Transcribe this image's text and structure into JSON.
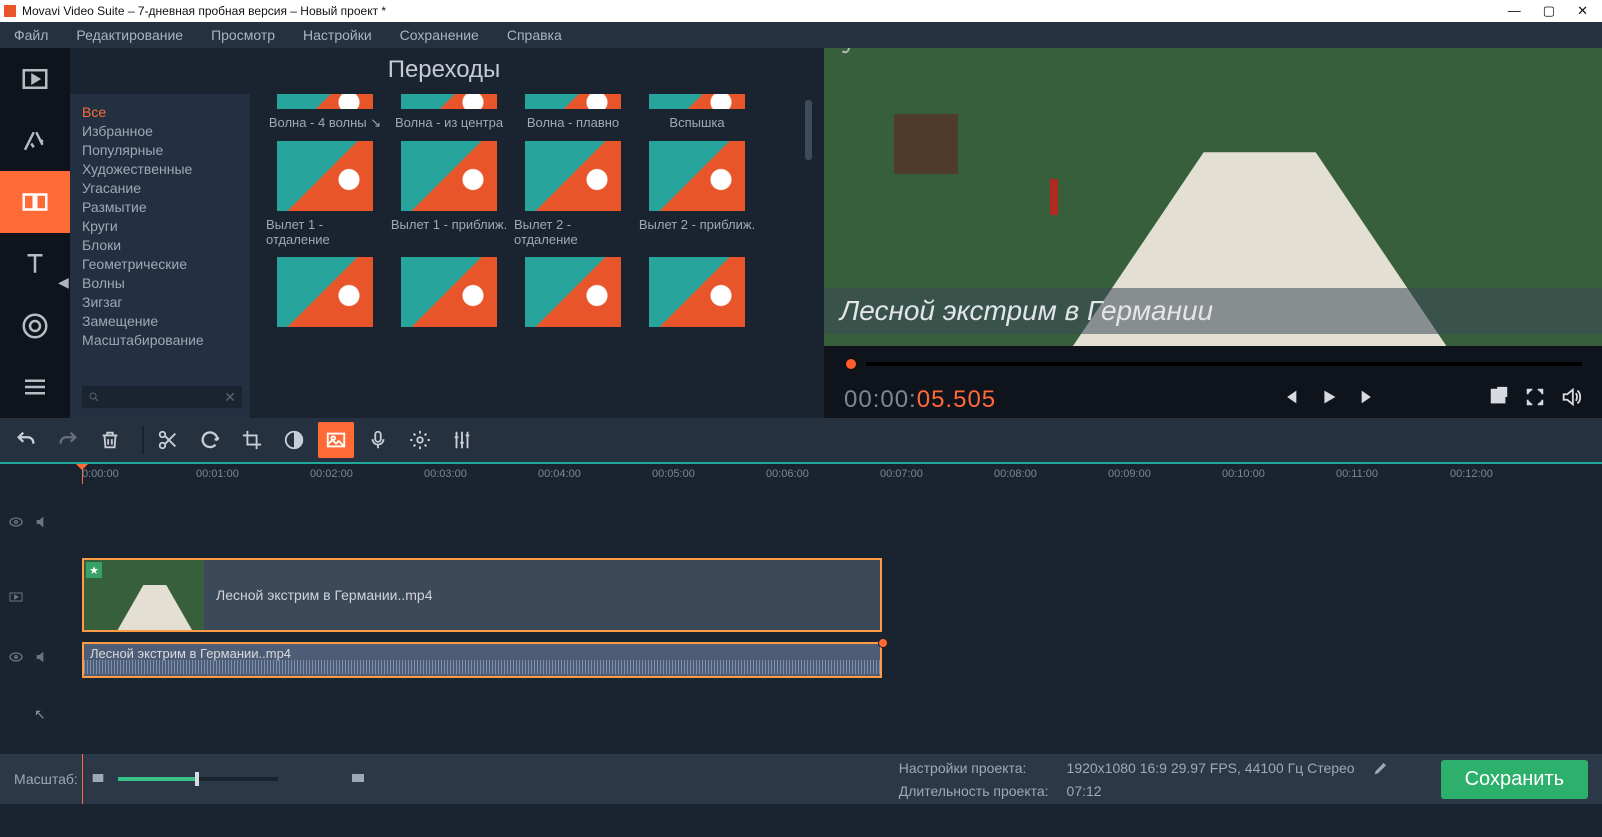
{
  "window": {
    "title": "Movavi Video Suite – 7-дневная пробная версия – Новый проект *"
  },
  "menu": [
    "Файл",
    "Редактирование",
    "Просмотр",
    "Настройки",
    "Сохранение",
    "Справка"
  ],
  "gallery": {
    "title": "Переходы",
    "categories": [
      "Все",
      "Избранное",
      "Популярные",
      "Художественные",
      "Угасание",
      "Размытие",
      "Круги",
      "Блоки",
      "Геометрические",
      "Волны",
      "Зигзаг",
      "Замещение",
      "Масштабирование"
    ],
    "active_category": 0,
    "row0": [
      "Волна - 4 волны ↘",
      "Волна - из центра",
      "Волна - плавно",
      "Вспышка"
    ],
    "row1": [
      "Вылет 1 - отдаление",
      "Вылет 1 - приближ.",
      "Вылет 2 - отдаление",
      "Вылет 2 - приближ."
    ]
  },
  "preview": {
    "watermark": "JkFam",
    "caption": "Лесной экстрим в Германии",
    "timecode_gray": "00:00:",
    "timecode_color": "05.505"
  },
  "ruler": [
    {
      "l": 82,
      "t": "0:00:00"
    },
    {
      "l": 196,
      "t": "00:01:00"
    },
    {
      "l": 310,
      "t": "00:02:00"
    },
    {
      "l": 424,
      "t": "00:03:00"
    },
    {
      "l": 538,
      "t": "00:04:00"
    },
    {
      "l": 652,
      "t": "00:05:00"
    },
    {
      "l": 766,
      "t": "00:06:00"
    },
    {
      "l": 880,
      "t": "00:07:00"
    },
    {
      "l": 994,
      "t": "00:08:00"
    },
    {
      "l": 1108,
      "t": "00:09:00"
    },
    {
      "l": 1222,
      "t": "00:10:00"
    },
    {
      "l": 1336,
      "t": "00:11:00"
    },
    {
      "l": 1450,
      "t": "00:12:00"
    }
  ],
  "clips": {
    "video_label": "Лесной экстрим в Германии..mp4",
    "audio_label": "Лесной экстрим в Германии..mp4"
  },
  "footer": {
    "zoom_label": "Масштаб:",
    "settings_label": "Настройки проекта:",
    "settings_value": "1920x1080 16:9 29.97 FPS, 44100 Гц Стерео",
    "duration_label": "Длительность проекта:",
    "duration_value": "07:12",
    "save": "Сохранить"
  }
}
